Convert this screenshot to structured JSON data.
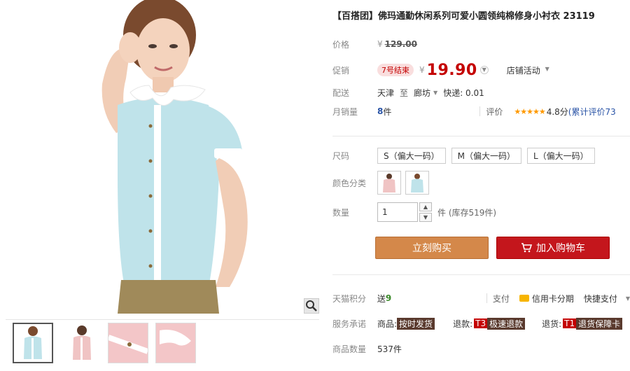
{
  "product": {
    "title": "【百搭团】佛玛通勤休闲系列可爱小圆领纯棉修身小衬衣 23119"
  },
  "price": {
    "label": "价格",
    "currency": "¥",
    "original": "129.00"
  },
  "promo": {
    "label": "促销",
    "badge": "7号结束",
    "currency": "¥",
    "price": "19.90",
    "store_activity": "店铺活动"
  },
  "delivery": {
    "label": "配送",
    "from": "天津",
    "to_word": "至",
    "dest": "廊坊",
    "shipping": "快递: 0.01"
  },
  "sales": {
    "label": "月销量",
    "count": "8",
    "unit": "件",
    "rating_label": "评价",
    "stars": "★★★★★",
    "score": "4.8分",
    "review_text": "(累计评价73"
  },
  "size": {
    "label": "尺码",
    "options": [
      "S（偏大一码）",
      "M（偏大一码）",
      "L（偏大一码）"
    ]
  },
  "color": {
    "label": "颜色分类"
  },
  "quantity": {
    "label": "数量",
    "value": "1",
    "unit_stock": "件 (库存519件)"
  },
  "actions": {
    "buy_now": "立刻购买",
    "add_cart": "加入购物车"
  },
  "points": {
    "label": "天猫积分",
    "give": "送",
    "value": "9",
    "pay_label": "支付",
    "installment": "信用卡分期",
    "quick_pay": "快捷支付"
  },
  "service": {
    "label": "服务承诺",
    "goods_label": "商品:",
    "goods_tag": "按时发货",
    "refund_label": "退款:",
    "refund_code": "T3",
    "refund_tag": "极速退款",
    "return_label": "退货:",
    "return_code": "T1",
    "return_tag": "退货保障卡"
  },
  "stock": {
    "label": "商品数量",
    "value": "537件"
  },
  "colors": {
    "accent_red": "#c40000",
    "buy_now": "#d4884a",
    "add_cart": "#c4161c",
    "shirt_blue": "#bfe3ea",
    "shirt_pink": "#f0c4c4"
  }
}
